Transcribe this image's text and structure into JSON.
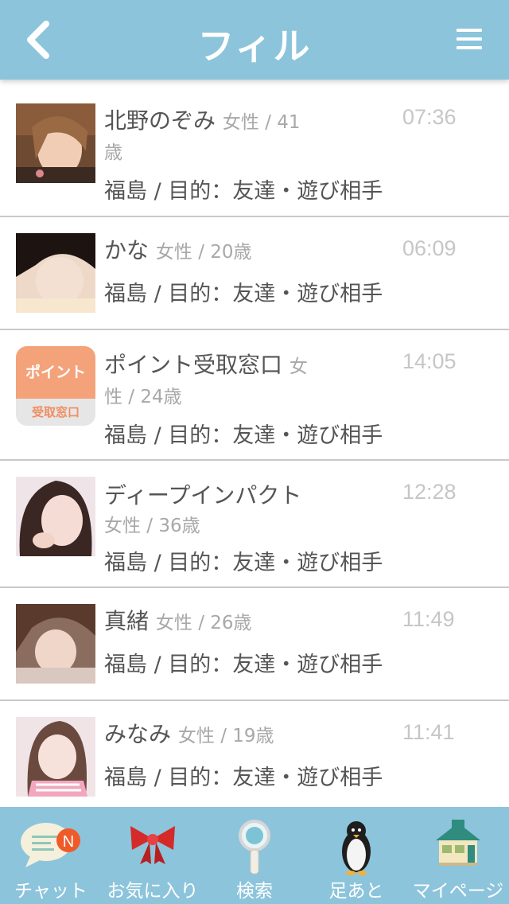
{
  "header": {
    "title": "フィル"
  },
  "rows": [
    {
      "name": "北野のぞみ",
      "meta_a": "女性 / 41",
      "meta_b": "歳",
      "time": "07:36",
      "desc": "福島 / 目的：友達・遊び相手"
    },
    {
      "name": "かな",
      "meta": "女性 / 20歳",
      "time": "06:09",
      "desc": "福島 / 目的：友達・遊び相手"
    },
    {
      "name": "ポイント受取窓口",
      "meta_a": "女",
      "meta_b": "性 / 24歳",
      "time": "14:05",
      "desc": "福島 / 目的：友達・遊び相手",
      "badge_top": "ポイント",
      "badge_bottom": "受取窓口"
    },
    {
      "name": "ディープインパクト",
      "meta": "女性 / 36歳",
      "time": "12:28",
      "desc": "福島 / 目的：友達・遊び相手"
    },
    {
      "name": "真緒",
      "meta": "女性 / 26歳",
      "time": "11:49",
      "desc": "福島 / 目的：友達・遊び相手"
    },
    {
      "name": "みなみ",
      "meta": "女性 / 19歳",
      "time": "11:41",
      "desc": "福島 / 目的：友達・遊び相手"
    }
  ],
  "tabs": [
    {
      "label": "チャット",
      "badge": "N"
    },
    {
      "label": "お気に入り"
    },
    {
      "label": "検索"
    },
    {
      "label": "足あと"
    },
    {
      "label": "マイページ"
    }
  ],
  "colors": {
    "accent": "#8cc4db",
    "badge": "#f4a27a",
    "notification": "#f05a28"
  }
}
